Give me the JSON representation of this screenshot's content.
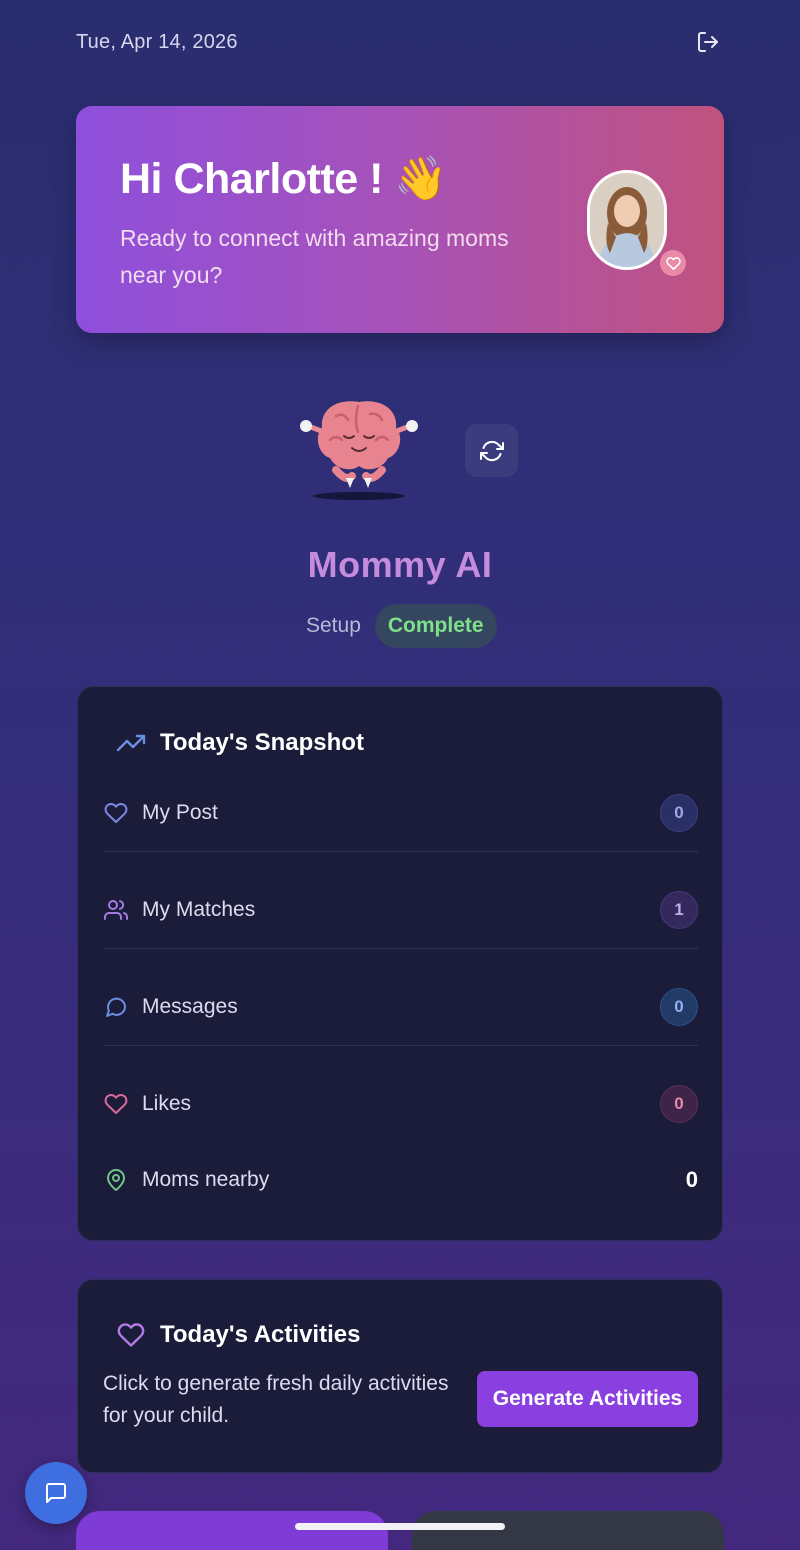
{
  "header": {
    "date": "Tue, Apr 14, 2026",
    "logout_icon": "logout-icon"
  },
  "hero": {
    "greeting": "Hi Charlotte ! 👋",
    "subtitle": "Ready to connect with amazing moms near you?",
    "avatar_icon": "profile-photo",
    "badge_icon": "heart-icon"
  },
  "ai": {
    "name": "Mommy AI",
    "setup_label": "Setup",
    "status": "Complete",
    "refresh_icon": "refresh-icon"
  },
  "snapshot": {
    "title": "Today's Snapshot",
    "title_icon": "trending-up-icon",
    "rows": [
      {
        "label": "My Post",
        "count": "0",
        "icon": "heart-icon",
        "color": "#7d86e0"
      },
      {
        "label": "My Matches",
        "count": "1",
        "icon": "users-icon",
        "color": "#a57be0"
      },
      {
        "label": "Messages",
        "count": "0",
        "icon": "message-icon",
        "color": "#6a8fe0"
      },
      {
        "label": "Likes",
        "count": "0",
        "icon": "heart-icon",
        "color": "#d86a9a"
      },
      {
        "label": "Moms nearby",
        "count": "0",
        "icon": "map-pin-icon",
        "color": "#6fc487"
      }
    ]
  },
  "activities": {
    "title": "Today's Activities",
    "title_icon": "heart-icon",
    "description": "Click to generate fresh daily activities for your child.",
    "button_label": "Generate Activities"
  },
  "chat_icon": "chat-icon",
  "colors": {
    "accent": "#8a3fe0",
    "card": "#1b1c3a",
    "success": "#7fe08a"
  }
}
